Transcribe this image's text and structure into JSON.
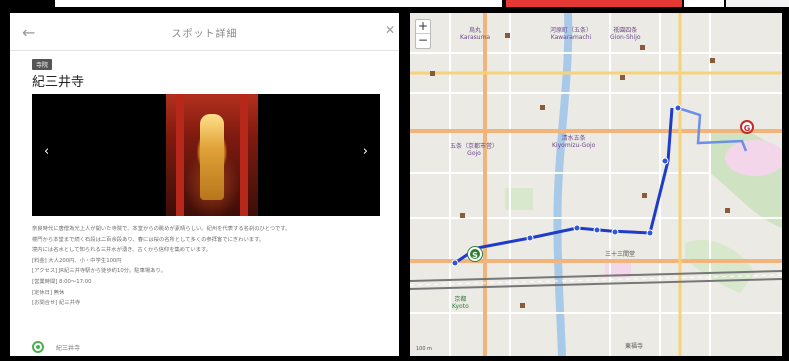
{
  "colors": {
    "accent_tab": "#e53935",
    "route": "#1f3bc9",
    "route_walk": "#6d8fe6",
    "start": "#2e7d32",
    "goal": "#c62828"
  },
  "spot": {
    "header_title": "スポット詳細",
    "tag": "寺院",
    "title": "紀三井寺",
    "description_lines": [
      "奈良時代に唐僧為光上人が開いた寺院で、本堂からの眺めが素晴らしい。紀州を代表する名刹のひとつです。",
      "楼門から本堂まで続く石段は二百余段あり、春には桜の名所として多くの参拝客でにぎわいます。",
      "境内には名水として知られる三井水が湧き、古くから信仰を集めています。",
      "[料金] 大人200円、小・中学生100円",
      "[アクセス] JR紀三井寺駅から徒歩約10分。駐車場あり。",
      "[営業時間] 8:00～17:00",
      "[定休日] 無休",
      "[お問合せ] 紀三井寺"
    ],
    "address": "紀三井寺"
  },
  "icons": {
    "back": "arrow-left-icon",
    "close": "close-icon",
    "prev": "chevron-left-icon",
    "next": "chevron-right-icon",
    "location": "location-pin-icon"
  },
  "map": {
    "zoom_in": "+",
    "zoom_out": "−",
    "start_label": "S",
    "goal_label": "G",
    "labels": {
      "karasuma": "烏丸\nKarasuma",
      "kawaramachi": "河原町（五条）\nKawaramachi",
      "gionshijo": "祇園四条\nGion-Shijo",
      "gojo": "五条（京都市営）\nGojo",
      "kiyomizu": "清水五条\nKiyomizu-Gojo",
      "kyoto": "京都\nKyoto",
      "sanjusangendo": "三十三間堂",
      "tofukuji": "東福寺"
    },
    "scale": "100 m"
  }
}
